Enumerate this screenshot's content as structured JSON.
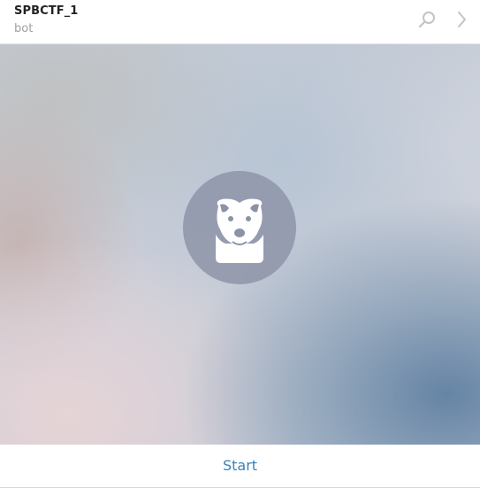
{
  "header": {
    "title": "SPBCTF_1",
    "status": "bot",
    "icons": {
      "search": "search-icon",
      "next": "chevron-right-icon"
    }
  },
  "chat": {
    "avatar_icon": "bot-dog-icon"
  },
  "footer": {
    "start_label": "Start"
  },
  "colors": {
    "accent": "#3a82b8",
    "title": "#222222",
    "subtitle": "#a0a0a0",
    "avatar_bg": "#8c92a6"
  }
}
